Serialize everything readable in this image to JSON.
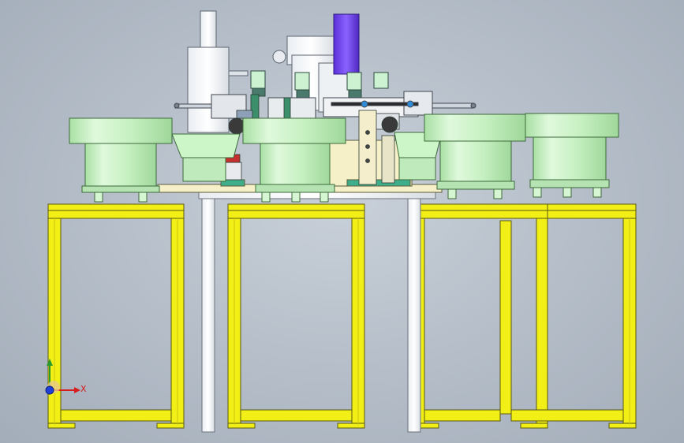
{
  "viewport": {
    "type": "cad-3d-view",
    "background": "#b6bec9"
  },
  "triad": {
    "x_label": "X",
    "y_label": "",
    "x_color": "#d61e1e",
    "y_color": "#2a9a2a",
    "z_color": "#1f3fd6"
  },
  "model": {
    "frame_color": "#f2ef16",
    "bowl_color": "#ccf5c8",
    "tower_color": "#6a3cf0",
    "base_color": "#f6f0c8"
  }
}
